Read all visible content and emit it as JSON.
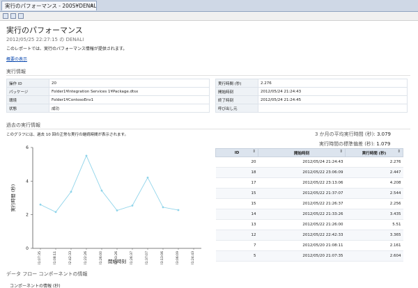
{
  "window": {
    "tab_title": "実行のパフォーマンス - 200S¥DENALI",
    "tab_close": "×"
  },
  "toolbar": {
    "icons": [
      "save-icon",
      "refresh-icon",
      "print-icon"
    ]
  },
  "report": {
    "title": "実行のパフォーマンス",
    "subtitle": "2012/05/25 22:27:15 の DENALI",
    "description": "このレポートでは、実行のパフォーマンス情報が提供されます。",
    "overview_link": "概要の表示"
  },
  "execution_info": {
    "heading": "実行情報",
    "left": [
      {
        "key": "操作 ID",
        "value": "20"
      },
      {
        "key": "パッケージ",
        "value": "Folder1¥Integration Services 1¥Package.dtsx"
      },
      {
        "key": "環境",
        "value": "Folder1¥ContosoEnv1"
      },
      {
        "key": "状態",
        "value": "成功"
      }
    ],
    "right": [
      {
        "key": "実行時間 (秒)",
        "value": "2.276"
      },
      {
        "key": "開始時刻",
        "value": "2012/05/24 21:24:43"
      },
      {
        "key": "終了時刻",
        "value": "2012/05/24 21:24:45"
      },
      {
        "key": "呼び出し元",
        "value": ""
      }
    ]
  },
  "past_info": {
    "heading": "過去の実行情報",
    "hint": "このグラフには、過去 10 回の正常な実行の継続時間が表示されます。",
    "avg_label": "3 か月の平均実行時間 (秒):",
    "avg_value": "3.079",
    "std_label": "実行時間の標準偏差 (秒):",
    "std_value": "1.079"
  },
  "chart_data": {
    "type": "line",
    "categories": [
      "5/20/2012 21:07:35",
      "5/20/2012 21:08:11",
      "5/22/2012 22:42:33",
      "5/22/2012 21:22:26",
      "5/22/2012 21:26:00",
      "5/22/2012 21:33:26",
      "5/22/2012 21:26:37",
      "5/22/2012 21:37:07",
      "5/22/2012 23:13:06",
      "5/22/2012 23:06:09",
      "5/24/2012 21:24:43"
    ],
    "values": [
      2.604,
      2.161,
      3.365,
      5.51,
      3.435,
      2.256,
      2.544,
      4.208,
      2.447,
      2.276
    ],
    "ylabel": "実行時間 (秒)",
    "xlabel": "開始時刻",
    "ylim": [
      0,
      6
    ],
    "yticks": [
      "0",
      "2",
      "4",
      "6"
    ],
    "grid": false,
    "line_color": "#8fd4ea"
  },
  "runs_table": {
    "headers": [
      "ID",
      "開始時刻",
      "実行時間 (秒)"
    ],
    "sort_icon": "⇕",
    "rows": [
      [
        "20",
        "2012/05/24 21:24:43",
        "2.276"
      ],
      [
        "18",
        "2012/05/22 23:06:09",
        "2.447"
      ],
      [
        "17",
        "2012/05/22 23:13:06",
        "4.208"
      ],
      [
        "15",
        "2012/05/22 21:37:07",
        "2.544"
      ],
      [
        "15",
        "2012/05/22 21:26:37",
        "2.256"
      ],
      [
        "14",
        "2012/05/22 21:33:26",
        "3.435"
      ],
      [
        "13",
        "2012/05/22 21:26:00",
        "5.51"
      ],
      [
        "12",
        "2012/05/22 22:42:33",
        "3.365"
      ],
      [
        "7",
        "2012/05/20 21:08:11",
        "2.161"
      ],
      [
        "5",
        "2012/05/20 21:07:35",
        "2.604"
      ]
    ]
  },
  "dataflow": {
    "heading": "データ フロー コンポーネントの情報",
    "item": "コンポーネントの情報 (秒)"
  },
  "colors": {
    "accent": "#0645ad",
    "header_bg": "#dce4ee"
  }
}
